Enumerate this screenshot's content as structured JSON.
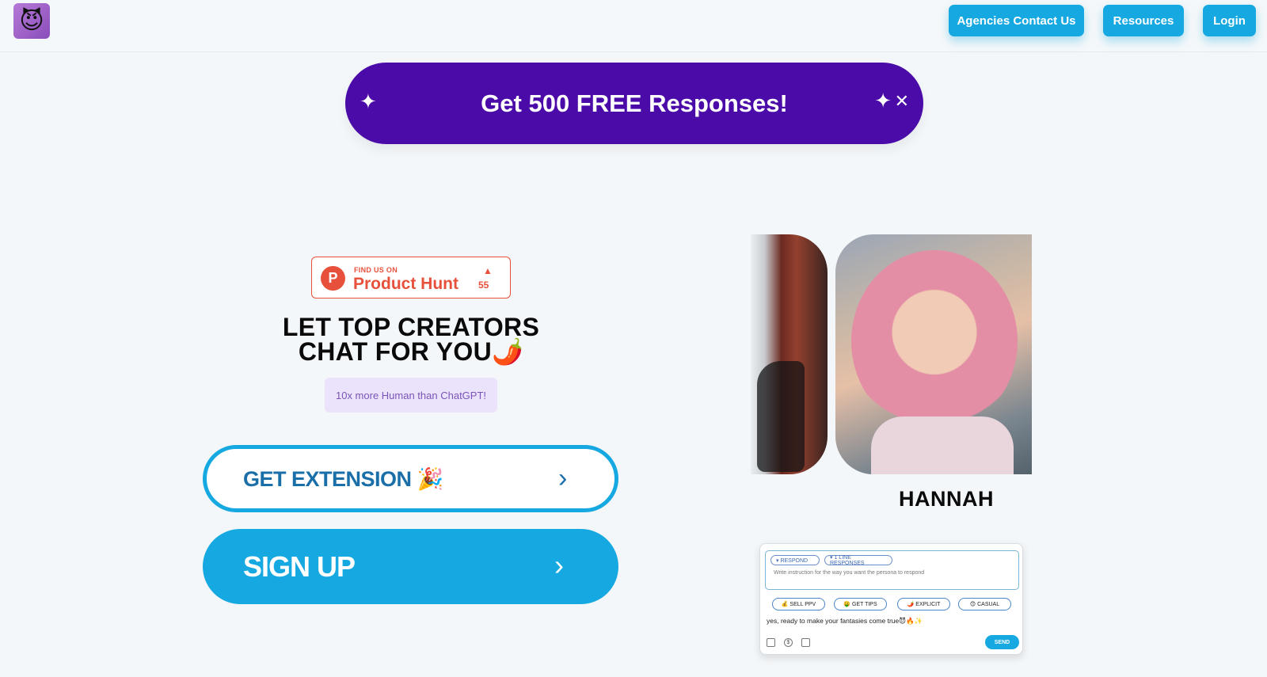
{
  "header": {
    "logo_emoji": "😈",
    "nav": {
      "agencies_label": "Agencies Contact Us",
      "resources_label": "Resources",
      "login_label": "Login"
    }
  },
  "promo": {
    "text": "Get 500 FREE Responses!",
    "sparkle": "✦",
    "close": "✕"
  },
  "product_hunt": {
    "find_us": "FIND US ON",
    "name": "Product Hunt",
    "letter": "P",
    "arrow": "▲",
    "upvotes": "55"
  },
  "hero": {
    "headline_line1": "LET TOP CREATORS",
    "headline_line2": "CHAT FOR YOU🌶️",
    "tagline": "10x more Human than ChatGPT!"
  },
  "buttons": {
    "extension_label": "GET EXTENSION 🎉",
    "signup_label": "SIGN UP",
    "chevron": "›"
  },
  "persona": {
    "name": "HANNAH"
  },
  "chat_widget": {
    "respond_label": "▾ RESPOND",
    "line_responses_label": "▾ 1 LINE RESPONSES",
    "instruction_placeholder": "Write instruction for the way you want the persona to respond",
    "chips": [
      "💰 SELL PPV",
      "🤑 GET TIPS",
      "🌶️ EXPLICIT",
      "😊 CASUAL"
    ],
    "message": "yes, ready to make your fantasies come true😈🔥✨",
    "send_label": "SEND"
  },
  "colors": {
    "accent": "#16a8e0",
    "banner": "#4a0ba8",
    "product_hunt": "#e7513b"
  }
}
